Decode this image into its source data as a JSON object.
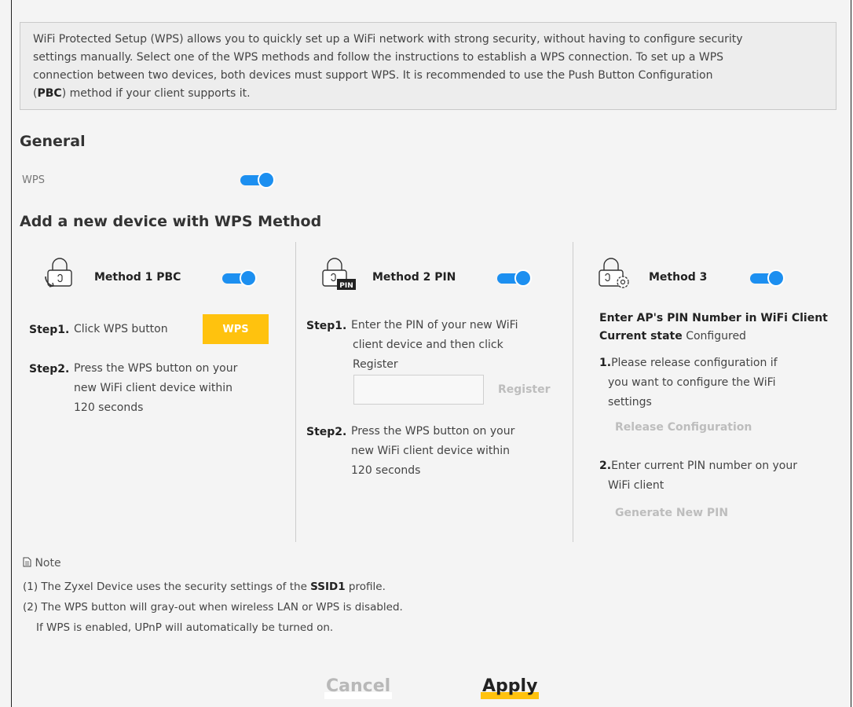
{
  "intro": {
    "line1": "WiFi Protected Setup (WPS) allows you to quickly set up a WiFi network with strong security, without having to configure security",
    "line2": "settings manually. Select one of the WPS methods and follow the instructions to establish a WPS connection. To set up a WPS",
    "line3": "connection between two devices, both devices must support WPS. It is recommended to use the Push Button Configuration",
    "line4_open": "(",
    "line4_bold": "PBC",
    "line4_rest": ") method if your client supports it."
  },
  "general": {
    "title": "General",
    "wps_label": "WPS",
    "wps_enabled": true
  },
  "add_device": {
    "title": "Add a new device with WPS Method"
  },
  "method1": {
    "title": "Method 1 PBC",
    "enabled": true,
    "step1_label": "Step1.",
    "step1_text": "Click WPS button",
    "wps_button": "WPS",
    "step2_label": "Step2.",
    "step2_line1": "Press the WPS button on your",
    "step2_line2": "new WiFi client device within",
    "step2_line3": "120 seconds"
  },
  "method2": {
    "title": "Method 2 PIN",
    "enabled": true,
    "icon_badge": "PIN",
    "step1_label": "Step1.",
    "step1_line1": "Enter the PIN of your new WiFi",
    "step1_line2": "client device and then click",
    "step1_line3": "Register",
    "pin_value": "",
    "register_button": "Register",
    "step2_label": "Step2.",
    "step2_line1": "Press the WPS button on your",
    "step2_line2": "new WiFi client device within",
    "step2_line3": "120 seconds"
  },
  "method3": {
    "title": "Method 3",
    "enabled": true,
    "heading": "Enter AP's PIN Number in WiFi Client",
    "state_label": "Current state",
    "state_value": "Configured",
    "item1_num": "1.",
    "item1_line1": "Please release configuration if",
    "item1_line2": "you want to configure the WiFi",
    "item1_line3": "settings",
    "release_button": "Release Configuration",
    "item2_num": "2.",
    "item2_line1": "Enter current PIN number on your",
    "item2_line2": "WiFi client",
    "generate_button": "Generate New PIN"
  },
  "note": {
    "title": "Note",
    "line1_pre": "(1) The Zyxel Device uses the security settings of the ",
    "line1_bold": "SSID1",
    "line1_post": " profile.",
    "line2": "(2) The WPS button will gray-out when wireless LAN or WPS is disabled.",
    "line3": "If WPS is enabled, UPnP will automatically be turned on."
  },
  "footer": {
    "cancel": "Cancel",
    "apply": "Apply"
  },
  "colors": {
    "accent_blue": "#1c8ff0",
    "accent_yellow": "#ffc20e"
  }
}
